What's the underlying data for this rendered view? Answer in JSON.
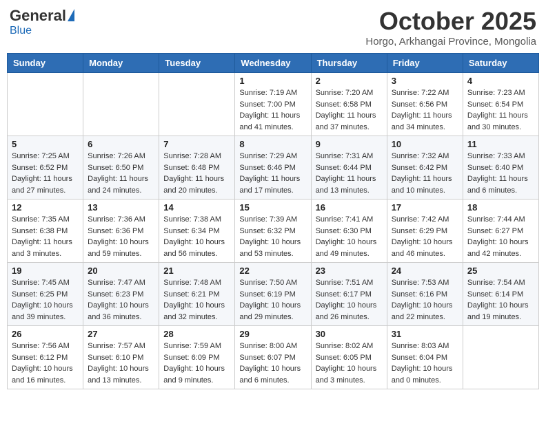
{
  "header": {
    "logo_general": "General",
    "logo_blue": "Blue",
    "month_title": "October 2025",
    "subtitle": "Horgo, Arkhangai Province, Mongolia"
  },
  "calendar": {
    "days_of_week": [
      "Sunday",
      "Monday",
      "Tuesday",
      "Wednesday",
      "Thursday",
      "Friday",
      "Saturday"
    ],
    "weeks": [
      [
        {
          "day": "",
          "info": ""
        },
        {
          "day": "",
          "info": ""
        },
        {
          "day": "",
          "info": ""
        },
        {
          "day": "1",
          "info": "Sunrise: 7:19 AM\nSunset: 7:00 PM\nDaylight: 11 hours and 41 minutes."
        },
        {
          "day": "2",
          "info": "Sunrise: 7:20 AM\nSunset: 6:58 PM\nDaylight: 11 hours and 37 minutes."
        },
        {
          "day": "3",
          "info": "Sunrise: 7:22 AM\nSunset: 6:56 PM\nDaylight: 11 hours and 34 minutes."
        },
        {
          "day": "4",
          "info": "Sunrise: 7:23 AM\nSunset: 6:54 PM\nDaylight: 11 hours and 30 minutes."
        }
      ],
      [
        {
          "day": "5",
          "info": "Sunrise: 7:25 AM\nSunset: 6:52 PM\nDaylight: 11 hours and 27 minutes."
        },
        {
          "day": "6",
          "info": "Sunrise: 7:26 AM\nSunset: 6:50 PM\nDaylight: 11 hours and 24 minutes."
        },
        {
          "day": "7",
          "info": "Sunrise: 7:28 AM\nSunset: 6:48 PM\nDaylight: 11 hours and 20 minutes."
        },
        {
          "day": "8",
          "info": "Sunrise: 7:29 AM\nSunset: 6:46 PM\nDaylight: 11 hours and 17 minutes."
        },
        {
          "day": "9",
          "info": "Sunrise: 7:31 AM\nSunset: 6:44 PM\nDaylight: 11 hours and 13 minutes."
        },
        {
          "day": "10",
          "info": "Sunrise: 7:32 AM\nSunset: 6:42 PM\nDaylight: 11 hours and 10 minutes."
        },
        {
          "day": "11",
          "info": "Sunrise: 7:33 AM\nSunset: 6:40 PM\nDaylight: 11 hours and 6 minutes."
        }
      ],
      [
        {
          "day": "12",
          "info": "Sunrise: 7:35 AM\nSunset: 6:38 PM\nDaylight: 11 hours and 3 minutes."
        },
        {
          "day": "13",
          "info": "Sunrise: 7:36 AM\nSunset: 6:36 PM\nDaylight: 10 hours and 59 minutes."
        },
        {
          "day": "14",
          "info": "Sunrise: 7:38 AM\nSunset: 6:34 PM\nDaylight: 10 hours and 56 minutes."
        },
        {
          "day": "15",
          "info": "Sunrise: 7:39 AM\nSunset: 6:32 PM\nDaylight: 10 hours and 53 minutes."
        },
        {
          "day": "16",
          "info": "Sunrise: 7:41 AM\nSunset: 6:30 PM\nDaylight: 10 hours and 49 minutes."
        },
        {
          "day": "17",
          "info": "Sunrise: 7:42 AM\nSunset: 6:29 PM\nDaylight: 10 hours and 46 minutes."
        },
        {
          "day": "18",
          "info": "Sunrise: 7:44 AM\nSunset: 6:27 PM\nDaylight: 10 hours and 42 minutes."
        }
      ],
      [
        {
          "day": "19",
          "info": "Sunrise: 7:45 AM\nSunset: 6:25 PM\nDaylight: 10 hours and 39 minutes."
        },
        {
          "day": "20",
          "info": "Sunrise: 7:47 AM\nSunset: 6:23 PM\nDaylight: 10 hours and 36 minutes."
        },
        {
          "day": "21",
          "info": "Sunrise: 7:48 AM\nSunset: 6:21 PM\nDaylight: 10 hours and 32 minutes."
        },
        {
          "day": "22",
          "info": "Sunrise: 7:50 AM\nSunset: 6:19 PM\nDaylight: 10 hours and 29 minutes."
        },
        {
          "day": "23",
          "info": "Sunrise: 7:51 AM\nSunset: 6:17 PM\nDaylight: 10 hours and 26 minutes."
        },
        {
          "day": "24",
          "info": "Sunrise: 7:53 AM\nSunset: 6:16 PM\nDaylight: 10 hours and 22 minutes."
        },
        {
          "day": "25",
          "info": "Sunrise: 7:54 AM\nSunset: 6:14 PM\nDaylight: 10 hours and 19 minutes."
        }
      ],
      [
        {
          "day": "26",
          "info": "Sunrise: 7:56 AM\nSunset: 6:12 PM\nDaylight: 10 hours and 16 minutes."
        },
        {
          "day": "27",
          "info": "Sunrise: 7:57 AM\nSunset: 6:10 PM\nDaylight: 10 hours and 13 minutes."
        },
        {
          "day": "28",
          "info": "Sunrise: 7:59 AM\nSunset: 6:09 PM\nDaylight: 10 hours and 9 minutes."
        },
        {
          "day": "29",
          "info": "Sunrise: 8:00 AM\nSunset: 6:07 PM\nDaylight: 10 hours and 6 minutes."
        },
        {
          "day": "30",
          "info": "Sunrise: 8:02 AM\nSunset: 6:05 PM\nDaylight: 10 hours and 3 minutes."
        },
        {
          "day": "31",
          "info": "Sunrise: 8:03 AM\nSunset: 6:04 PM\nDaylight: 10 hours and 0 minutes."
        },
        {
          "day": "",
          "info": ""
        }
      ]
    ]
  }
}
